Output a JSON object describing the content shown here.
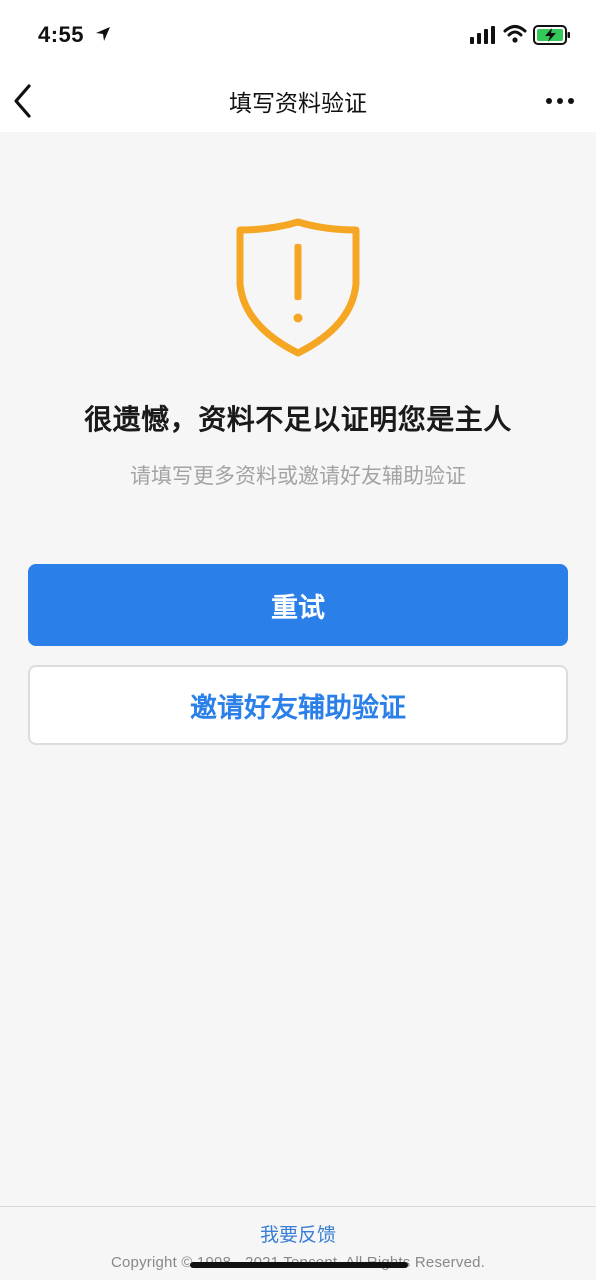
{
  "status_bar": {
    "time": "4:55",
    "icons": [
      "location-arrow-icon",
      "cellular-signal-icon",
      "wifi-icon",
      "battery-charging-icon"
    ],
    "battery_color": "#34c759"
  },
  "nav": {
    "title": "填写资料验证",
    "back_icon": "chevron-left-icon",
    "more_icon": "more-horizontal-icon"
  },
  "alert": {
    "icon": "shield-warning-icon",
    "icon_color": "#f5a623",
    "headline": "很遗憾，资料不足以证明您是主人",
    "subline": "请填写更多资料或邀请好友辅助验证"
  },
  "buttons": {
    "retry_label": "重试",
    "invite_label": "邀请好友辅助验证",
    "primary_color": "#2a7fe9"
  },
  "footer": {
    "feedback_label": "我要反馈",
    "copyright": "Copyright © 1998 - 2021 Tencent. All Rights Reserved."
  }
}
